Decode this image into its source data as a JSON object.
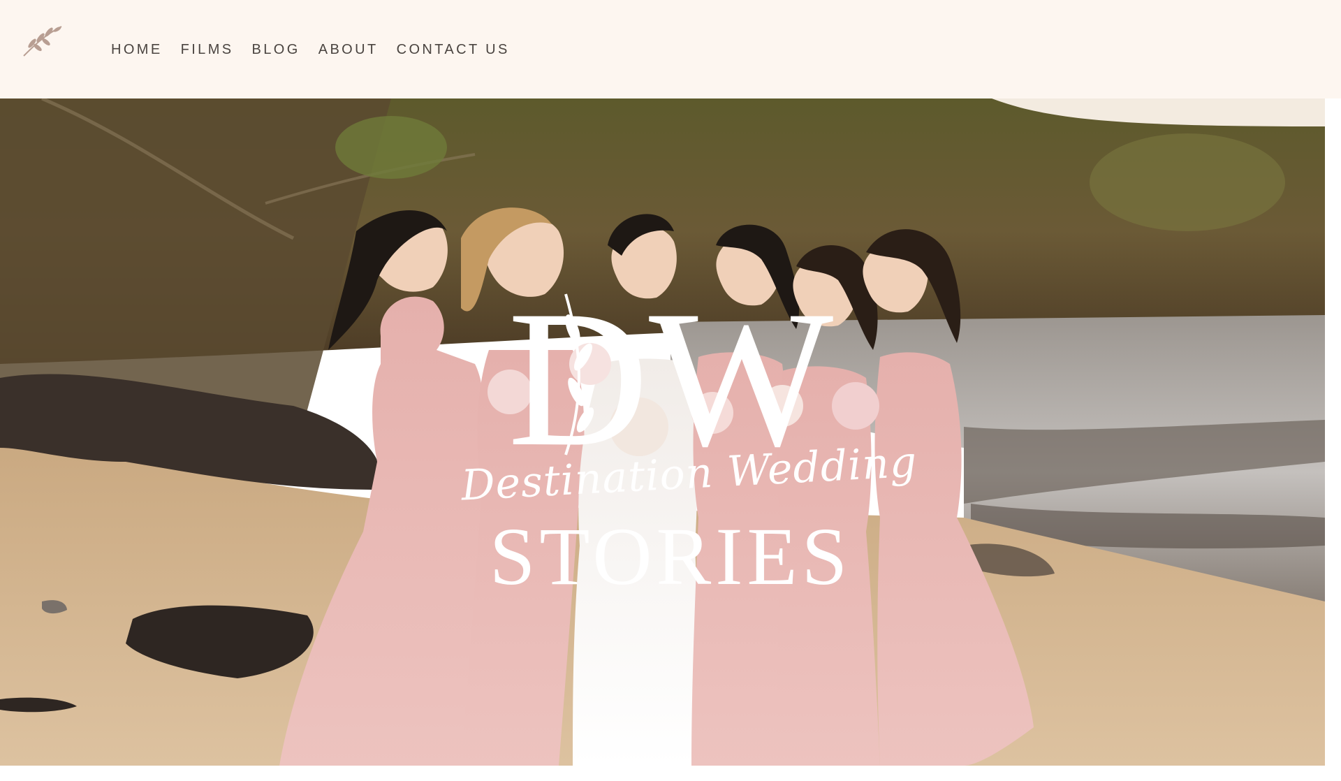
{
  "header": {
    "logo_icon": "leaf-branch-icon",
    "nav": [
      {
        "label": "HOME"
      },
      {
        "label": "FILMS"
      },
      {
        "label": "BLOG"
      },
      {
        "label": "ABOUT"
      },
      {
        "label": "CONTACT US"
      }
    ]
  },
  "hero": {
    "image_alt": "bride and bridesmaids on beach",
    "monogram": "DW",
    "script_line": "Destination Wedding",
    "title": "STORIES"
  },
  "colors": {
    "header_bg": "#fdf6f0",
    "nav_text": "#4a4440",
    "overlay_text": "#ffffff",
    "dress_pink": "#e8b7b5",
    "sand": "#d9bd9c"
  }
}
